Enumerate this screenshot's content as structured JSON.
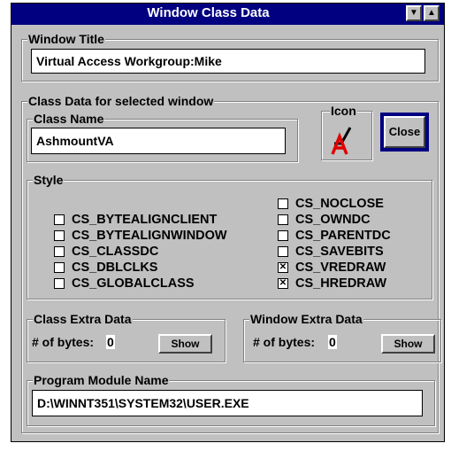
{
  "window": {
    "title": "Window Class Data",
    "dropdown_glyph": "▼",
    "maximize_glyph": "▲"
  },
  "window_title_group": {
    "label": "Window Title",
    "value": "Virtual Access Workgroup:Mike"
  },
  "class_data_group": {
    "label": "Class Data for selected window",
    "class_name_label": "Class Name",
    "class_name_value": "AshmountVA",
    "icon_label": "Icon",
    "close_label": "Close"
  },
  "style_group": {
    "label": "Style",
    "left_items": [
      {
        "label": "CS_BYTEALIGNCLIENT",
        "checked": false,
        "mark": ""
      },
      {
        "label": "CS_BYTEALIGNWINDOW",
        "checked": false,
        "mark": ""
      },
      {
        "label": "CS_CLASSDC",
        "checked": false,
        "mark": ""
      },
      {
        "label": "CS_DBLCLKS",
        "checked": false,
        "mark": ""
      },
      {
        "label": "CS_GLOBALCLASS",
        "checked": false,
        "mark": ""
      }
    ],
    "right_items": [
      {
        "label": "CS_NOCLOSE",
        "checked": false,
        "mark": ""
      },
      {
        "label": "CS_OWNDC",
        "checked": false,
        "mark": ""
      },
      {
        "label": "CS_PARENTDC",
        "checked": false,
        "mark": ""
      },
      {
        "label": "CS_SAVEBITS",
        "checked": false,
        "mark": ""
      },
      {
        "label": "CS_VREDRAW",
        "checked": true,
        "mark": "✕"
      },
      {
        "label": "CS_HREDRAW",
        "checked": true,
        "mark": "✕"
      }
    ]
  },
  "class_extra": {
    "label": "Class Extra Data",
    "bytes_label": "# of bytes:",
    "bytes_value": "0",
    "show_label": "Show"
  },
  "window_extra": {
    "label": "Window Extra Data",
    "bytes_label": "# of bytes:",
    "bytes_value": "0",
    "show_label": "Show"
  },
  "program_module": {
    "label": "Program Module Name",
    "value": "D:\\WINNT351\\SYSTEM32\\USER.EXE"
  },
  "colors": {
    "titlebar": "#000080",
    "dialog_bg": "#c0c0c0",
    "default_button_border": "#000080"
  }
}
